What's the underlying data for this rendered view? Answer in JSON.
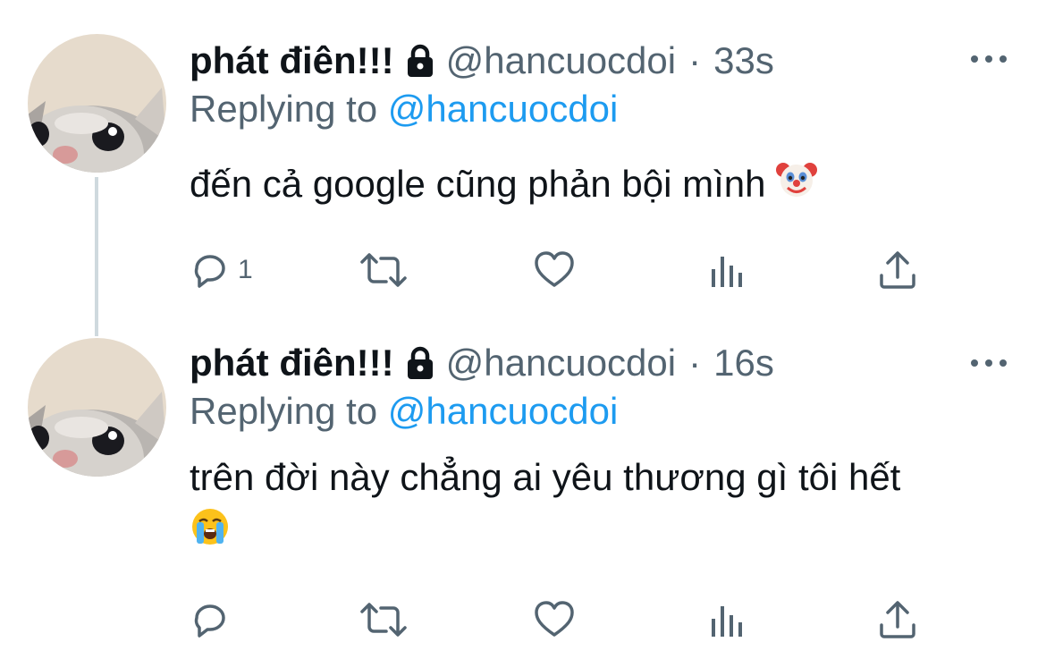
{
  "tweets": [
    {
      "author": {
        "display_name": "phát điên!!!",
        "handle": "@hancuocdoi",
        "locked": true,
        "avatar": "cat-avatar"
      },
      "separator": "·",
      "time": "33s",
      "replying_prefix": "Replying to",
      "replying_to": "@hancuocdoi",
      "text": "đến cả google cũng phản bội mình",
      "text_emoji": "clown-face-emoji",
      "reply_count": "1",
      "actions": [
        "reply-icon",
        "retweet-icon",
        "like-icon",
        "views-icon",
        "share-icon"
      ]
    },
    {
      "author": {
        "display_name": "phát điên!!!",
        "handle": "@hancuocdoi",
        "locked": true,
        "avatar": "cat-avatar"
      },
      "separator": "·",
      "time": "16s",
      "replying_prefix": "Replying to",
      "replying_to": "@hancuocdoi",
      "text": "trên đời này chẳng ai yêu thương gì tôi hết",
      "text_emoji": "loudly-crying-face-emoji",
      "reply_count": "",
      "actions": [
        "reply-icon",
        "retweet-icon",
        "like-icon",
        "views-icon",
        "share-icon"
      ]
    }
  ],
  "colors": {
    "text_primary": "#0f1419",
    "text_secondary": "#536471",
    "link": "#1d9bf0",
    "thread_line": "#cfd9de",
    "background": "#ffffff"
  }
}
